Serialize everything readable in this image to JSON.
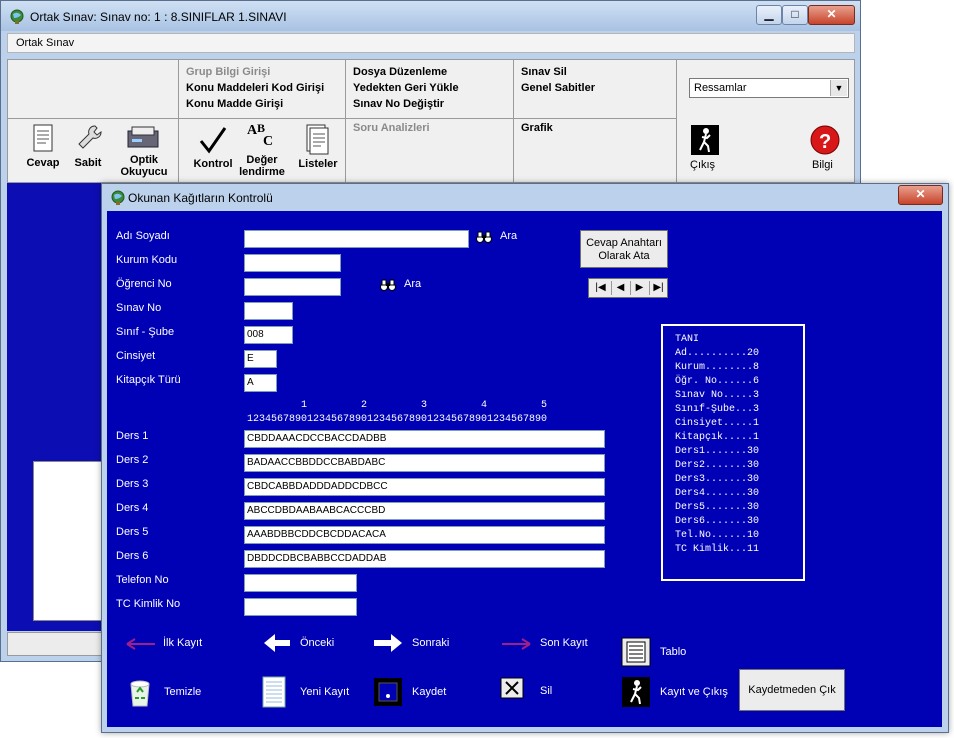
{
  "main_window": {
    "title": "Ortak Sınav:  Sınav no: 1 : 8.SINIFLAR 1.SINAVI",
    "menu": "Ortak Sınav",
    "links_col1": [
      "Grup Bilgi Girişi",
      "Konu Maddeleri Kod Girişi",
      "Konu Madde Girişi"
    ],
    "links_col2": [
      "Dosya Düzenleme",
      "Yedekten Geri Yükle",
      "Sınav No Değiştir"
    ],
    "links_col3": [
      "Sınav Sil",
      "Genel Sabitler"
    ],
    "soru_analizleri": "Soru Analizleri",
    "grafik": "Grafik",
    "dropdown_value": "Ressamlar",
    "tools": {
      "cevap": "Cevap",
      "sabit": "Sabit",
      "optik_1": "Optik",
      "optik_2": "Okuyucu",
      "kontrol": "Kontrol",
      "deger_1": "Değer",
      "deger_2": "lendirme",
      "listeler": "Listeler",
      "cikis": "Çıkış",
      "bilgi": "Bilgi"
    }
  },
  "dialog": {
    "title": "Okunan Kağıtların Kontrolü",
    "labels": {
      "adi_soyadi": "Adı Soyadı",
      "kurum_kodu": "Kurum Kodu",
      "ogrenci_no": "Öğrenci No",
      "sinav_no": "Sınav No",
      "sinif_sube": "Sınıf - Şube",
      "cinsiyet": "Cinsiyet",
      "kitapcik": "Kitapçık Türü",
      "telefon": "Telefon  No",
      "tc": "TC Kimlik No",
      "ara1": "Ara",
      "ara2": "Ara"
    },
    "values": {
      "adi_soyadi": "",
      "kurum_kodu": "",
      "ogrenci_no": "",
      "sinav_no": "",
      "sinif_sube": "008",
      "cinsiyet": "E",
      "kitapcik": "A",
      "telefon": "",
      "tc": ""
    },
    "ruler_tens": "         1         2         3         4         5",
    "ruler_units": "12345678901234567890123456789012345678901234567890",
    "ders": [
      {
        "label": "Ders 1",
        "value": "CBDDAAACDCCBACCDADBB"
      },
      {
        "label": "Ders 2",
        "value": "BADAACCBBDDCCBABDABC"
      },
      {
        "label": "Ders 3",
        "value": "CBDCABBDADDDADDCDBCC"
      },
      {
        "label": "Ders 4",
        "value": "ABCCDBDAABAABCACCCBD"
      },
      {
        "label": "Ders 5",
        "value": "AAABDBBCDDCBCDDACACA"
      },
      {
        "label": "Ders 6",
        "value": "DBDDCDBCBABBCCDADDAB"
      }
    ],
    "cevap_btn_1": "Cevap Anahtarı",
    "cevap_btn_2": "Olarak Ata",
    "tani_lines": [
      "TANI",
      "Ad..........20",
      "Kurum........8",
      "Öğr. No......6",
      "Sınav No.....3",
      "Sınıf-Şube...3",
      "Cinsiyet.....1",
      "Kitapçık.....1",
      "Ders1.......30",
      "Ders2.......30",
      "Ders3.......30",
      "Ders4.......30",
      "Ders5.......30",
      "Ders6.......30",
      "Tel.No......10",
      "TC Kimlik...11"
    ],
    "nav": {
      "ilk": "İlk Kayıt",
      "onceki": "Önceki",
      "sonraki": "Sonraki",
      "son": "Son Kayıt",
      "tablo": "Tablo",
      "temizle": "Temizle",
      "yeni": "Yeni Kayıt",
      "kaydet": "Kaydet",
      "sil": "Sil",
      "kayit_cikis": "Kayıt ve Çıkış",
      "kaydetmeden": "Kaydetmeden Çık"
    }
  }
}
